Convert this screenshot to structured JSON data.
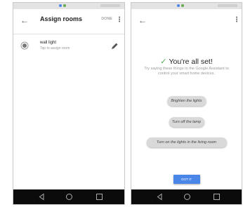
{
  "colors": {
    "accent": "#4a86e8",
    "success": "#4caf50",
    "navbar": "#0b0b0b",
    "statusbar": "#e3e3e3"
  },
  "screen1": {
    "title": "Assign rooms",
    "done_label": "DONE",
    "more_icon": "more-vert-icon",
    "back_icon": "arrow-back-icon",
    "device": {
      "name": "wall light",
      "subtitle": "Tap to assign room",
      "icon": "lightbulb-icon",
      "edit_icon": "pencil-icon"
    }
  },
  "screen2": {
    "back_icon": "arrow-back-icon",
    "more_icon": "more-vert-icon",
    "heading": "You're all set!",
    "check_icon": "check-icon",
    "description": "Try saying these things to the Google Assistant to control your smart home devices.",
    "suggestions": [
      "Brighten the lights",
      "Turn off the lamp",
      "Turn on the lights in the living room"
    ],
    "button_label": "GOT IT"
  },
  "navbar": {
    "icons": [
      "nav-back-icon",
      "nav-home-icon",
      "nav-recent-icon"
    ]
  }
}
